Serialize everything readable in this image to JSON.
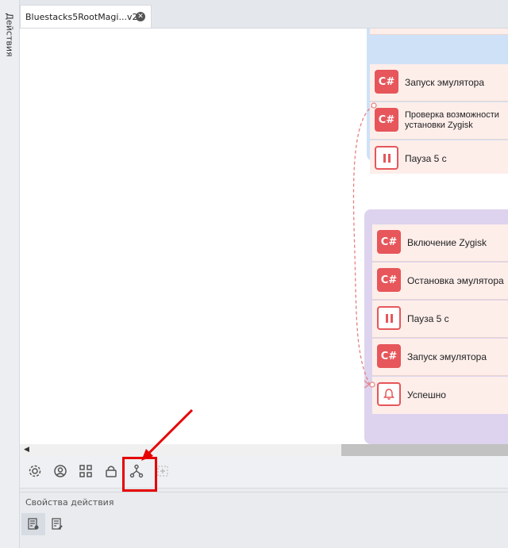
{
  "left_panel": {
    "label": "Действия"
  },
  "tab": {
    "title": "Bluestacks5RootMagi...v2",
    "close_icon": "close-icon"
  },
  "groups": {
    "blue": {
      "nodes": [
        {
          "label": "Запуск эмулятора",
          "icon": "C#"
        },
        {
          "label": "Проверка возможности установки Zygisk",
          "icon": "C#"
        },
        {
          "label": "Пауза 5 с",
          "icon": "pause-icon"
        }
      ]
    },
    "purple": {
      "nodes": [
        {
          "label": "Включение Zygisk",
          "icon": "C#"
        },
        {
          "label": "Остановка эмулятора",
          "icon": "C#"
        },
        {
          "label": "Пауза 5 с",
          "icon": "pause-icon"
        },
        {
          "label": "Запуск эмулятора",
          "icon": "C#"
        },
        {
          "label": "Успешно",
          "icon": "bell-icon"
        }
      ]
    }
  },
  "toolbar": {
    "icons": [
      "settings-icon",
      "profile-icon",
      "grid-icon",
      "lock-icon",
      "branch-icon",
      "add-node-icon"
    ]
  },
  "properties": {
    "title": "Свойства действия"
  },
  "colors": {
    "accent": "#e6565a",
    "blue_group": "#cfe1f7",
    "purple_group": "#ddd3ee",
    "annotation": "#e60000"
  }
}
